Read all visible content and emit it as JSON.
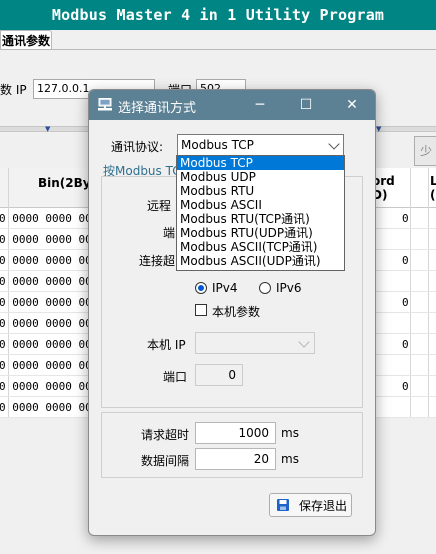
{
  "app": {
    "title": "Modbus Master 4 in 1 Utility Program",
    "tab_label": "通讯参数",
    "ip_label": "数 IP",
    "ip_value": "127.0.0.1",
    "port_label": "端口",
    "port_value": "502",
    "right_button_glyph": "少",
    "grid": {
      "headers": [
        "Bin(2Byt",
        "ord\nD)",
        "L\n("
      ],
      "rows": [
        {
          "bin": "0 0000 0000 00",
          "dec": "0"
        },
        {
          "bin": "0 0000 0000 00",
          "dec": ""
        },
        {
          "bin": "0 0000 0000 00",
          "dec": "0"
        },
        {
          "bin": "0 0000 0000 00",
          "dec": ""
        },
        {
          "bin": "0 0000 0000 00",
          "dec": "0"
        },
        {
          "bin": "0 0000 0000 00",
          "dec": ""
        },
        {
          "bin": "0 0000 0000 00",
          "dec": "0"
        },
        {
          "bin": "0 0000 0000 00",
          "dec": ""
        },
        {
          "bin": "0 0000 0000 00",
          "dec": "0"
        },
        {
          "bin": "0 0000 0000 00",
          "dec": ""
        }
      ]
    }
  },
  "dialog": {
    "title": "选择通讯方式",
    "minimize_glyph": "─",
    "maximize_glyph": "☐",
    "close_glyph": "✕",
    "protocol_label": "通讯协议:",
    "protocol_selected": "Modbus TCP",
    "protocol_options": [
      "Modbus TCP",
      "Modbus UDP",
      "Modbus RTU",
      "Modbus ASCII",
      "Modbus RTU(TCP通讯)",
      "Modbus RTU(UDP通讯)",
      "Modbus ASCII(TCP通讯)",
      "Modbus ASCII(UDP通讯)"
    ],
    "group_caption": "按Modbus TC",
    "remote_label": "远程",
    "port_label_short": "端",
    "connect_timeout_label": "连接超",
    "ipv4_label": "IPv4",
    "ipv6_label": "IPv6",
    "local_params_label": "本机参数",
    "local_ip_label": "本机 IP",
    "local_port_label": "端口",
    "local_port_value": "0",
    "request_timeout_label": "请求超时",
    "request_timeout_value": "1000",
    "request_timeout_unit": "ms",
    "data_interval_label": "数据间隔",
    "data_interval_value": "20",
    "data_interval_unit": "ms",
    "save_button_label": "保存退出"
  }
}
